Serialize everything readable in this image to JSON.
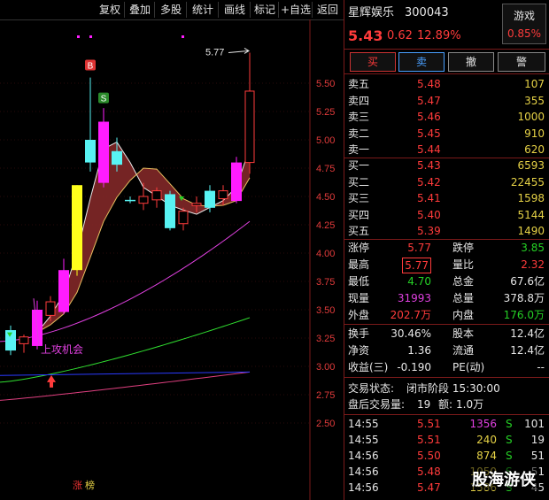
{
  "toolbar": {
    "buttons": [
      "复权",
      "叠加",
      "多股",
      "统计",
      "画线",
      "标记",
      "+自选",
      "返回"
    ]
  },
  "stock": {
    "name": "星辉娱乐",
    "code": "300043",
    "price": "5.43",
    "change": "0.62",
    "change_pct": "12.89%",
    "sector_label": "游戏",
    "sector_pct": "0.85%"
  },
  "trade_buttons": [
    "买",
    "卖",
    "撤",
    "警"
  ],
  "order_book": {
    "asks": [
      {
        "label": "卖五",
        "price": "5.48",
        "vol": "107"
      },
      {
        "label": "卖四",
        "price": "5.47",
        "vol": "355"
      },
      {
        "label": "卖三",
        "price": "5.46",
        "vol": "1000"
      },
      {
        "label": "卖二",
        "price": "5.45",
        "vol": "910"
      },
      {
        "label": "卖一",
        "price": "5.44",
        "vol": "620"
      }
    ],
    "bids": [
      {
        "label": "买一",
        "price": "5.43",
        "vol": "6593"
      },
      {
        "label": "买二",
        "price": "5.42",
        "vol": "22455"
      },
      {
        "label": "买三",
        "price": "5.41",
        "vol": "1598"
      },
      {
        "label": "买四",
        "price": "5.40",
        "vol": "5144"
      },
      {
        "label": "买五",
        "price": "5.39",
        "vol": "1490"
      }
    ]
  },
  "quote_stats": [
    [
      {
        "label": "涨停",
        "value": "5.77"
      },
      {
        "label": "跌停",
        "value": "3.85"
      }
    ],
    [
      {
        "label": "最高",
        "value": "5.77"
      },
      {
        "label": "量比",
        "value": "2.32"
      }
    ],
    [
      {
        "label": "最低",
        "value": "4.70"
      },
      {
        "label": "总金",
        "value": "67.6亿"
      }
    ],
    [
      {
        "label": "现量",
        "value": "31993"
      },
      {
        "label": "总量",
        "value": "378.8万"
      }
    ],
    [
      {
        "label": "外盘",
        "value": "202.7万"
      },
      {
        "label": "内盘",
        "value": "176.0万"
      }
    ]
  ],
  "fund_stats": [
    [
      {
        "label": "换手",
        "value": "30.46%"
      },
      {
        "label": "股本",
        "value": "12.4亿"
      }
    ],
    [
      {
        "label": "净资",
        "value": "1.36"
      },
      {
        "label": "流通",
        "value": "12.4亿"
      }
    ],
    [
      {
        "label": "收益(三)",
        "value": "-0.190"
      },
      {
        "label": "PE(动)",
        "value": "--"
      }
    ]
  ],
  "trade_status": {
    "label": "交易状态:",
    "value": "闭市阶段 15:30:00"
  },
  "after_hours": {
    "label": "盘后交易量:",
    "vol": "19",
    "amt_label": "额:",
    "amt": "1.0万"
  },
  "ticks": [
    {
      "time": "14:55",
      "price": "5.51",
      "vol": "1356",
      "side": "S",
      "count": "101"
    },
    {
      "time": "14:55",
      "price": "5.51",
      "vol": "240",
      "side": "S",
      "count": "19"
    },
    {
      "time": "14:56",
      "price": "5.50",
      "vol": "874",
      "side": "S",
      "count": "51"
    },
    {
      "time": "14:56",
      "price": "5.48",
      "vol": "1050",
      "side": "S",
      "count": "51"
    },
    {
      "time": "14:56",
      "price": "5.47",
      "vol": "1586",
      "side": "S",
      "count": "45"
    }
  ],
  "watermark": "股海游侠",
  "chart": {
    "y_ticks": [
      "5.50",
      "5.25",
      "5.00",
      "4.75",
      "4.50",
      "4.25",
      "4.00",
      "3.75",
      "3.50",
      "3.25",
      "3.00",
      "2.75",
      "2.50"
    ],
    "high_label": "5.77",
    "buy_marker": "B",
    "sell_marker": "S",
    "annotation": "上攻机会",
    "bottom_markers": [
      "涨",
      "榜"
    ],
    "candles": [
      {
        "o": 3.32,
        "h": 3.36,
        "l": 3.1,
        "c": 3.14,
        "col": "cyan"
      },
      {
        "o": 3.2,
        "h": 3.28,
        "l": 3.12,
        "c": 3.26,
        "col": "hollow"
      },
      {
        "o": 3.18,
        "h": 3.58,
        "l": 3.15,
        "c": 3.5,
        "col": "magenta"
      },
      {
        "o": 3.45,
        "h": 3.62,
        "l": 3.4,
        "c": 3.57,
        "col": "hollow"
      },
      {
        "o": 3.48,
        "h": 3.95,
        "l": 3.46,
        "c": 3.85,
        "col": "magenta"
      },
      {
        "o": 3.85,
        "h": 4.6,
        "l": 3.8,
        "c": 4.6,
        "col": "yellow"
      },
      {
        "o": 4.8,
        "h": 5.55,
        "l": 4.72,
        "c": 5.0,
        "col": "cyan"
      },
      {
        "o": 4.62,
        "h": 5.28,
        "l": 4.58,
        "c": 5.16,
        "col": "magenta"
      },
      {
        "o": 4.9,
        "h": 5.02,
        "l": 4.72,
        "c": 4.78,
        "col": "cyan"
      },
      {
        "o": 4.47,
        "h": 4.5,
        "l": 4.44,
        "c": 4.46,
        "col": "cyan"
      },
      {
        "o": 4.44,
        "h": 4.62,
        "l": 4.38,
        "c": 4.5,
        "col": "hollow"
      },
      {
        "o": 4.47,
        "h": 4.58,
        "l": 4.4,
        "c": 4.55,
        "col": "hollow"
      },
      {
        "o": 4.52,
        "h": 4.55,
        "l": 4.2,
        "c": 4.22,
        "col": "cyan"
      },
      {
        "o": 4.26,
        "h": 4.4,
        "l": 4.2,
        "c": 4.37,
        "col": "hollow"
      },
      {
        "o": 4.42,
        "h": 4.5,
        "l": 4.36,
        "c": 4.44,
        "col": "hollow"
      },
      {
        "o": 4.55,
        "h": 4.6,
        "l": 4.36,
        "c": 4.4,
        "col": "cyan"
      },
      {
        "o": 4.48,
        "h": 4.6,
        "l": 4.42,
        "c": 4.55,
        "col": "hollow"
      },
      {
        "o": 4.46,
        "h": 4.85,
        "l": 4.44,
        "c": 4.8,
        "col": "magenta"
      },
      {
        "o": 4.8,
        "h": 5.77,
        "l": 4.7,
        "c": 5.43,
        "col": "hollow"
      }
    ]
  },
  "colors": {
    "up": "#ff3b3b",
    "down": "#25d025",
    "cyan": "#58f3f3",
    "magenta": "#ff1cff",
    "yellow": "#ffff1c",
    "ma_fill": "#8a2a2a",
    "ma_fill_light": "#b7d39a"
  }
}
